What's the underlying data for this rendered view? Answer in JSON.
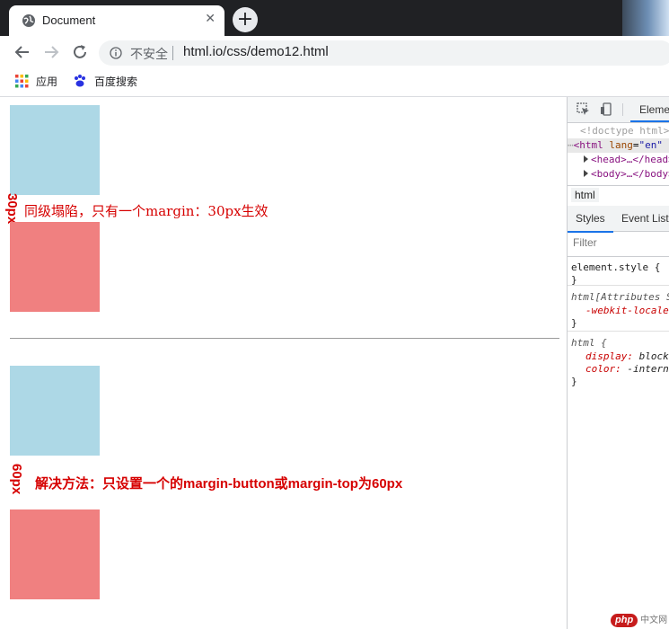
{
  "browser": {
    "tab_title": "Document",
    "tab_close": "✕",
    "new_tab": "+",
    "security_label": "不安全",
    "url": "html.io/css/demo12.html",
    "bookmarks": [
      {
        "label": "应用",
        "icon": "apps-grid-icon"
      },
      {
        "label": "百度搜索",
        "icon": "baidu-paw-icon"
      }
    ]
  },
  "page": {
    "label_30px": "30px",
    "note_collapse": "同级塌陷，只有一个margin：30px生效",
    "label_60px": "60px",
    "note_solution": "解决方法：只设置一个的margin-button或margin-top为60px",
    "colors": {
      "blue_box": "#add8e6",
      "red_box": "#f08080",
      "annotation": "#d60000"
    }
  },
  "devtools": {
    "elements_tab": "Elements",
    "dom": {
      "doctype": "<!doctype html>",
      "html_tag": "<html",
      "lang_attr": "lang",
      "lang_value": "\"en\"",
      "head": "<head>…</head>",
      "body": "<body>…</body>"
    },
    "breadcrumb": "html",
    "styles_tab": "Styles",
    "event_listeners_tab": "Event Listeners",
    "filter_placeholder": "Filter",
    "rules": {
      "element_style": "element.style {",
      "close": "}",
      "attr_selector": "html[Attributes Style] {",
      "attr_prop": "-webkit-locale: \"en\";",
      "html_selector": "html {",
      "display_prop": "display:",
      "display_val": "block;",
      "color_prop": "color:",
      "color_val": "-internal-root-color;"
    }
  },
  "watermark": {
    "logo": "php",
    "text": "中文网"
  }
}
